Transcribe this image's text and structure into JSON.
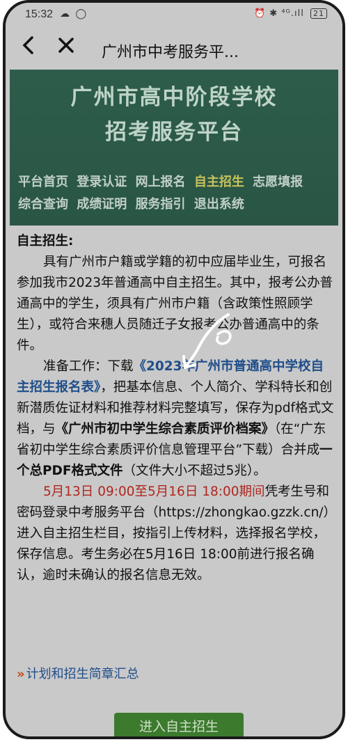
{
  "status_bar": {
    "time": "15:32",
    "left_icons": "☁ ◯",
    "right_icons": "⏰ ✱ ⁴ᴳ.ıll",
    "battery": "21"
  },
  "nav": {
    "title": "广州市中考服务平..."
  },
  "banner": {
    "title_line1": "广州市高中阶段学校",
    "title_line2": "招考服务平台"
  },
  "menu": {
    "row1": [
      "平台首页",
      "登录认证",
      "网上报名",
      "自主招生",
      "志愿填报"
    ],
    "row2": [
      "综合查询",
      "成绩证明",
      "服务指引",
      "退出系统"
    ],
    "active": "自主招生"
  },
  "section": {
    "heading": "自主招生:",
    "para1": "具有广州市户籍或学籍的初中应届毕业生，可报名参加我市2023年普通高中自主招生。其中，报考公办普通高中的学生，须具有广州市户籍（含政策性照顾学生），或符合来穗人员随迁子女报考公办普通高中的条件。",
    "prep_label": "准备工作：",
    "download_prefix": "下载",
    "form_name_1": "《2023年广州市普通高中学校自主",
    "form_name_2": "招生报名表》",
    "para2_rest": "，把基本信息、个人简介、学科特长和创新潜质佐证材料和推荐材料完整填写，保存为pdf格式文档，与",
    "archive_name": "《广州市初中学生综合素质评价档案》",
    "para2_rest2": "（在“广东省初中学生综合素质评价信息管理平台”下载）合并成",
    "single_pdf": "一个总PDF格式文件",
    "para2_end": "（文件大小不超过5兆）。",
    "period": "5月13日 09:00至5月16日 18:00期间",
    "para3_rest": "凭考生号和密码登录中考服务平台（https://zhongkao.gzzk.cn/）进入自主招生栏目，按指引上传材料，选择报名学校，保存信息。考生务必在5月16日 18:00前进行报名确认，逾时未确认的报名信息无效。"
  },
  "links": {
    "plan_summary": "计划和招生简章汇总"
  },
  "button": {
    "enter": "进入自主招生"
  }
}
